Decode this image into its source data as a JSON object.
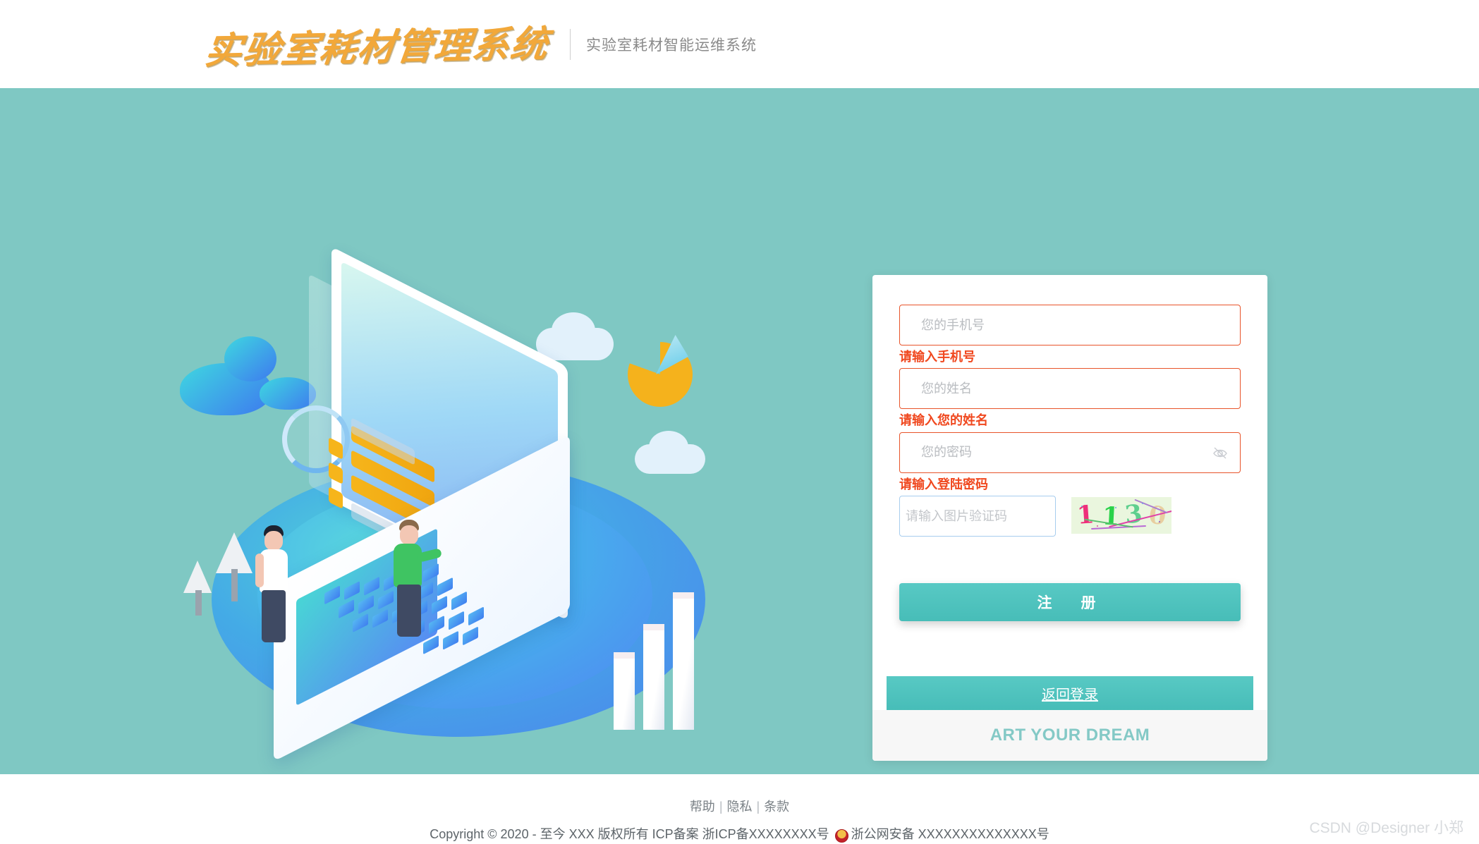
{
  "header": {
    "logo_text": "实验室耗材管理系统",
    "subtitle": "实验室耗材智能运维系统"
  },
  "theme": {
    "background_teal": "#7fc8c3",
    "accent_teal": "#4cc2bd",
    "error_red": "#f0481f",
    "input_border_red": "#e8542a",
    "captcha_border_blue": "#a7cdee"
  },
  "form": {
    "phone": {
      "placeholder": "您的手机号",
      "value": "",
      "error": "请输入手机号"
    },
    "name": {
      "placeholder": "您的姓名",
      "value": "",
      "error": "请输入您的姓名"
    },
    "password": {
      "placeholder": "您的密码",
      "value": "",
      "error": "请输入登陆密码",
      "toggle_icon": "eye-slash-icon"
    },
    "captcha": {
      "placeholder": "请输入图片验证码",
      "value": "",
      "image_code": "1130",
      "image_chars": [
        {
          "ch": "1",
          "color": "#ee2f7a"
        },
        {
          "ch": "1",
          "color": "#2ad24a"
        },
        {
          "ch": "3",
          "color": "#5fcf8e"
        },
        {
          "ch": "0",
          "color": "#e8cfa0"
        }
      ],
      "image_background": "#eaf6de"
    },
    "register_button": "注　册",
    "back_button": "返回登录",
    "card_footer_slogan": "ART YOUR DREAM"
  },
  "footer": {
    "links": [
      "帮助",
      "隐私",
      "条款"
    ],
    "separator": "|",
    "copyright_prefix": "Copyright © 2020 - 至今 XXX 版权所有 ICP备案 浙ICP备XXXXXXXX号",
    "police_record": "浙公网安备 XXXXXXXXXXXXXX号",
    "police_icon": "police-badge-icon"
  },
  "watermark": "CSDN @Designer 小郑"
}
